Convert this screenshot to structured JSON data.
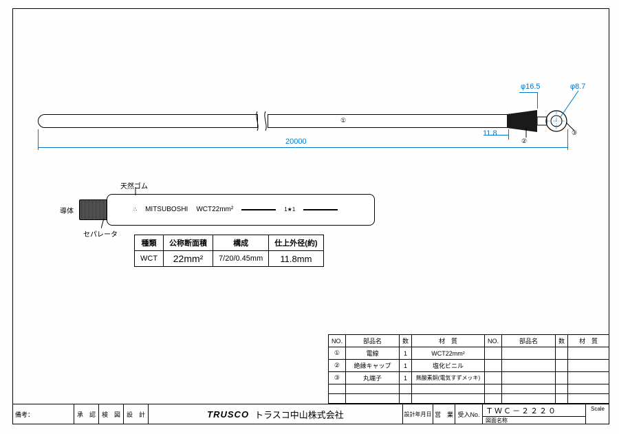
{
  "dimensions": {
    "overall_length": "20000",
    "plug_small": "11.8",
    "plug_large": "φ16.5",
    "terminal_hole": "φ8.7"
  },
  "callouts": {
    "c1": "①",
    "c2": "②",
    "c3": "③"
  },
  "cable_labels": {
    "conductor": "導体",
    "rubber": "天然ゴム",
    "separator": "セパレータ",
    "brand": "MITSUBOSHI",
    "size": "WCT22mm²",
    "star": "1★1"
  },
  "spec_table": {
    "headers": {
      "type": "種類",
      "area": "公称断面積",
      "comp": "構成",
      "od": "仕上外径(約)"
    },
    "row": {
      "type": "WCT",
      "area": "22mm²",
      "comp": "7/20/0.45mm",
      "od": "11.8mm"
    }
  },
  "parts": {
    "headers": {
      "no": "NO.",
      "name": "部品名",
      "qty": "数",
      "mat": "材　質"
    },
    "rows": [
      {
        "no": "①",
        "name": "電線",
        "qty": "1",
        "mat": "WCT22mm²"
      },
      {
        "no": "②",
        "name": "絶縁キャップ",
        "qty": "1",
        "mat": "塩化ビニル"
      },
      {
        "no": "③",
        "name": "丸端子",
        "qty": "1",
        "mat": "無酸素銅(電気すずメッキ)"
      }
    ]
  },
  "title_block": {
    "remarks": "備考：",
    "approve": "承　認",
    "check": "検　図",
    "design": "設　計",
    "logo": "TRUSCO",
    "company": "トラスコ中山株式会社",
    "date": "設計年月日",
    "business": "営　業",
    "recipient": "受入No.",
    "drawing_no": "ＴＷＣ－２２２０",
    "drawing_name_label": "図面名称",
    "scale": "Scale"
  }
}
